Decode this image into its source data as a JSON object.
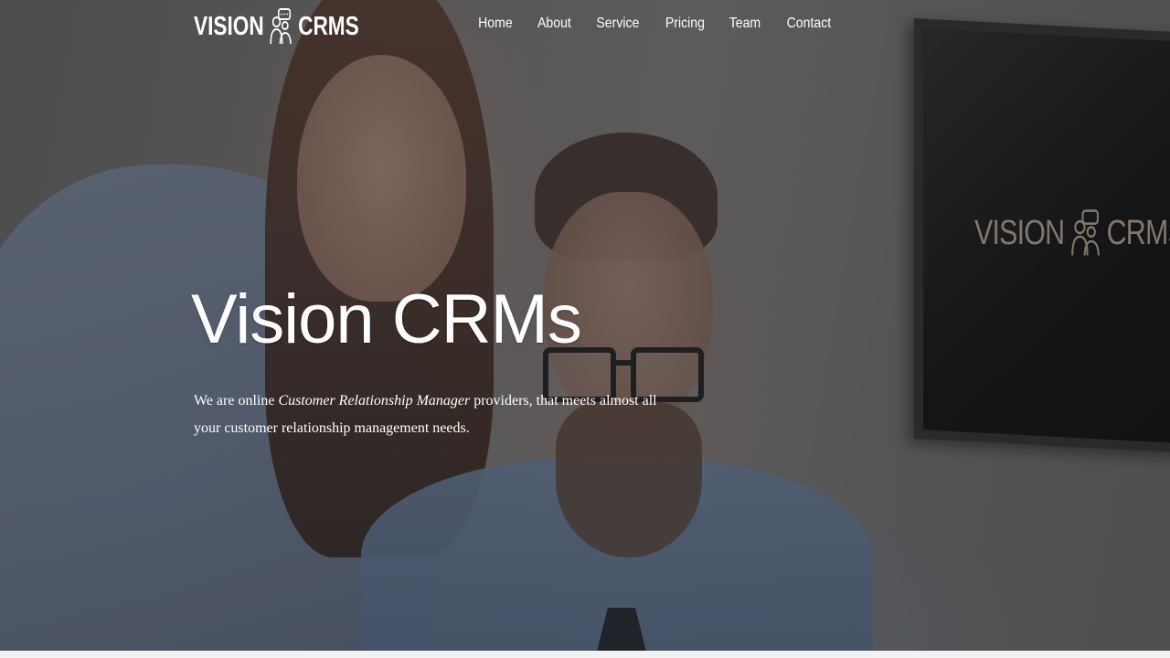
{
  "brand": {
    "left_word": "VISION",
    "right_word": "CRMS",
    "logo_icon": "people-chat-icon"
  },
  "nav": {
    "items": [
      {
        "label": "Home"
      },
      {
        "label": "About"
      },
      {
        "label": "Service"
      },
      {
        "label": "Pricing"
      },
      {
        "label": "Team"
      },
      {
        "label": "Contact"
      }
    ]
  },
  "hero": {
    "title": "Vision CRMs",
    "text_before": "We are online ",
    "text_emphasis": "Customer Relationship Manager",
    "text_after": " providers, that meets almost all your customer relationship management needs."
  },
  "monitor": {
    "left_word": "VISION",
    "right_word": "CRMS"
  },
  "colors": {
    "overlay": "#232328",
    "text": "#ffffff",
    "monitor_text": "#c7b49d"
  }
}
